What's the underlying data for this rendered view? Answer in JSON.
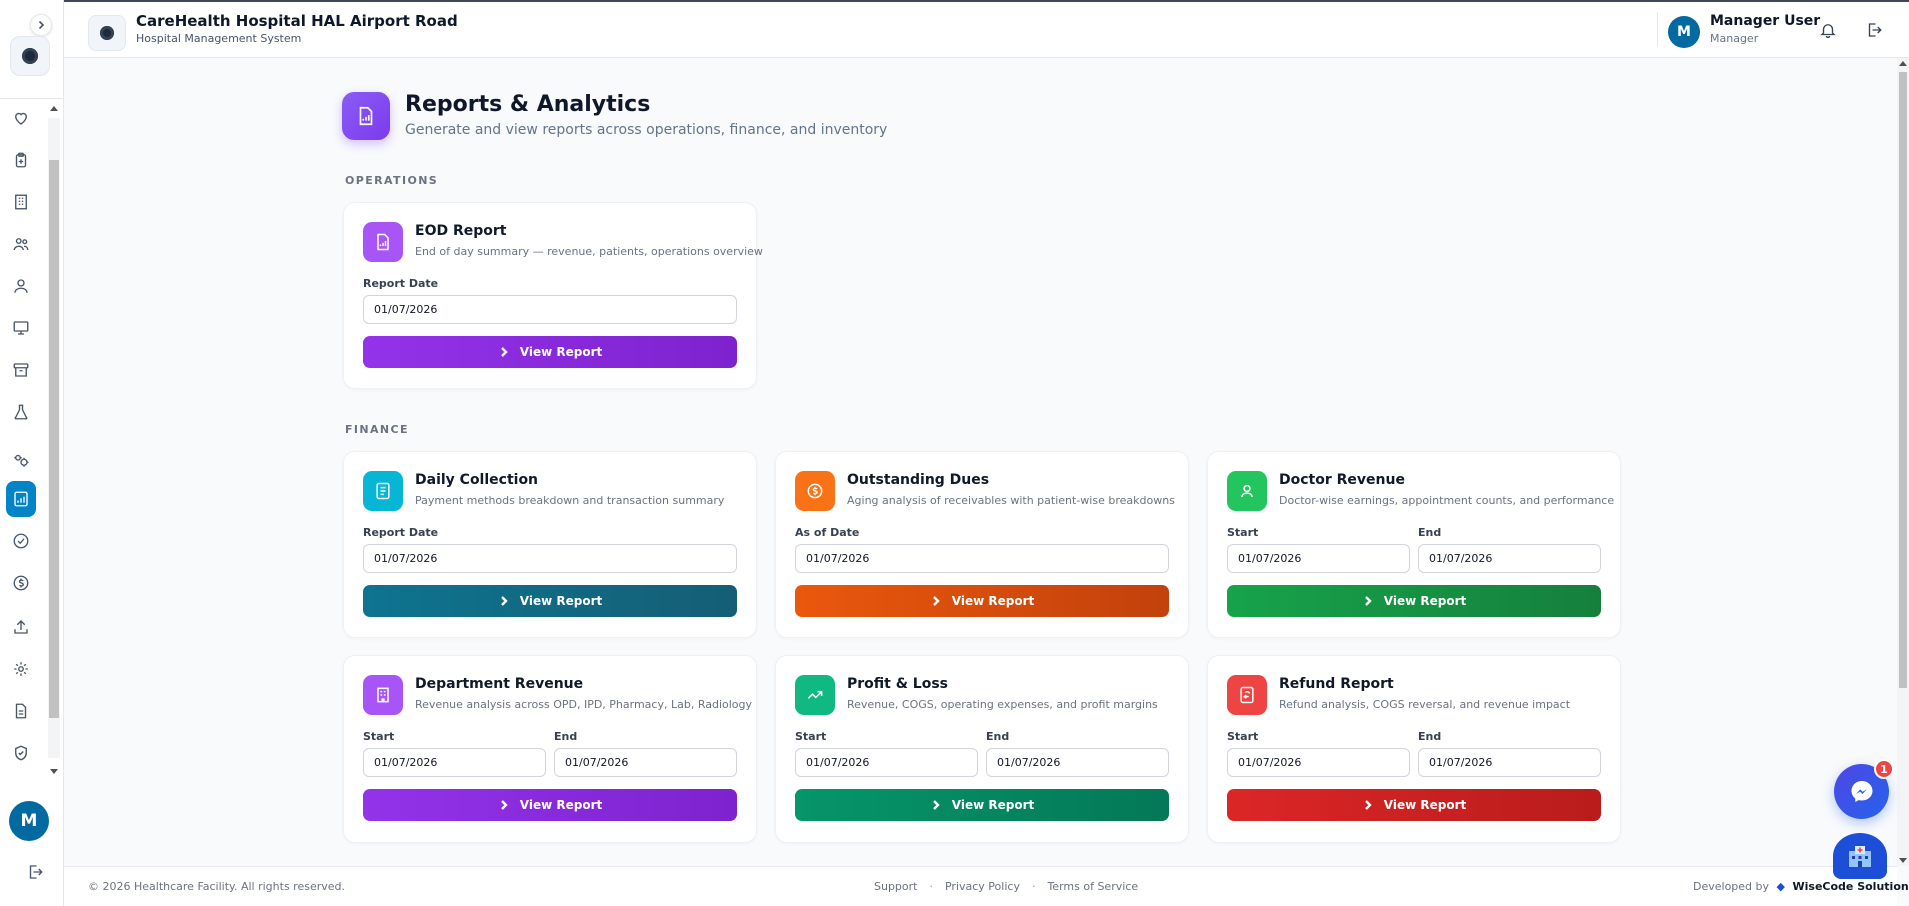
{
  "header": {
    "hospital_name": "CareHealth Hospital HAL Airport Road",
    "hospital_subtitle": "Hospital Management System",
    "user_initial": "M",
    "user_name": "Manager User",
    "user_role": "Manager"
  },
  "sidebar": {
    "items": [
      {
        "icon": "heart-icon"
      },
      {
        "icon": "clipboard-icon"
      },
      {
        "icon": "building-icon"
      },
      {
        "icon": "users-icon"
      },
      {
        "icon": "user-icon"
      },
      {
        "icon": "monitor-icon"
      },
      {
        "icon": "archive-icon"
      },
      {
        "icon": "flask-icon"
      },
      {
        "icon": "settings-group-icon"
      },
      {
        "icon": "reports-icon",
        "active": true
      },
      {
        "icon": "check-circle-icon"
      },
      {
        "icon": "dollar-icon"
      },
      {
        "icon": "upload-icon"
      },
      {
        "icon": "gear-icon"
      },
      {
        "icon": "document-icon"
      },
      {
        "icon": "shield-icon"
      }
    ],
    "avatar_initial": "M"
  },
  "page": {
    "title": "Reports & Analytics",
    "subtitle": "Generate and view reports across operations, finance, and inventory"
  },
  "sections": {
    "operations": "OPERATIONS",
    "finance": "FINANCE"
  },
  "cards": {
    "eod": {
      "title": "EOD Report",
      "desc": "End of day summary — revenue, patients, operations overview",
      "label": "Report Date",
      "value": "01/07/2026",
      "button": "View Report",
      "color": "#a855f7"
    },
    "daily_collection": {
      "title": "Daily Collection",
      "desc": "Payment methods breakdown and transaction summary",
      "label": "Report Date",
      "value": "01/07/2026",
      "button": "View Report",
      "color": "#06b6d4"
    },
    "outstanding_dues": {
      "title": "Outstanding Dues",
      "desc": "Aging analysis of receivables with patient-wise breakdowns",
      "label": "As of Date",
      "value": "01/07/2026",
      "button": "View Report",
      "color": "#f97316"
    },
    "doctor_revenue": {
      "title": "Doctor Revenue",
      "desc": "Doctor-wise earnings, appointment counts, and performance",
      "start_label": "Start",
      "start_value": "01/07/2026",
      "end_label": "End",
      "end_value": "01/07/2026",
      "button": "View Report",
      "color": "#22c55e"
    },
    "department_revenue": {
      "title": "Department Revenue",
      "desc": "Revenue analysis across OPD, IPD, Pharmacy, Lab, Radiology",
      "start_label": "Start",
      "start_value": "01/07/2026",
      "end_label": "End",
      "end_value": "01/07/2026",
      "button": "View Report",
      "color": "#a855f7"
    },
    "profit_loss": {
      "title": "Profit & Loss",
      "desc": "Revenue, COGS, operating expenses, and profit margins",
      "start_label": "Start",
      "start_value": "01/07/2026",
      "end_label": "End",
      "end_value": "01/07/2026",
      "button": "View Report",
      "color": "#10b981"
    },
    "refund": {
      "title": "Refund Report",
      "desc": "Refund analysis, COGS reversal, and revenue impact",
      "start_label": "Start",
      "start_value": "01/07/2026",
      "end_label": "End",
      "end_value": "01/07/2026",
      "button": "View Report",
      "color": "#ef4444"
    }
  },
  "footer": {
    "copyright": "© 2026 Healthcare Facility. All rights reserved.",
    "support": "Support",
    "privacy": "Privacy Policy",
    "terms": "Terms of Service",
    "developed_by": "Developed by",
    "company": "WiseCode Solutions"
  },
  "chat": {
    "badge_count": "1"
  }
}
